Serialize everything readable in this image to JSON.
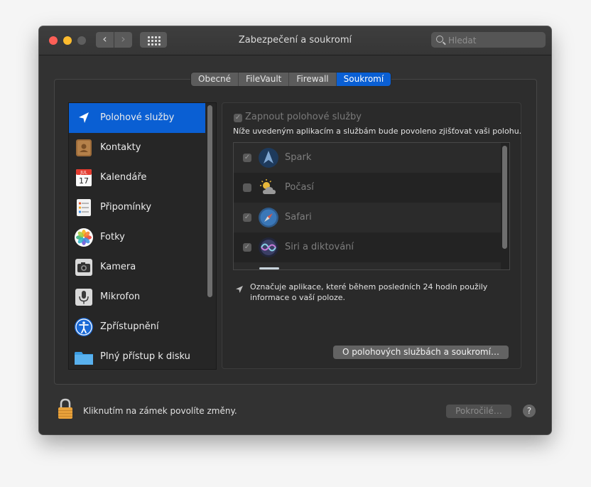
{
  "window": {
    "title": "Zabezpečení a soukromí"
  },
  "search": {
    "placeholder": "Hledat"
  },
  "tabs": [
    {
      "label": "Obecné",
      "active": false
    },
    {
      "label": "FileVault",
      "active": false
    },
    {
      "label": "Firewall",
      "active": false
    },
    {
      "label": "Soukromí",
      "active": true
    }
  ],
  "sidebar": {
    "items": [
      {
        "label": "Polohové služby",
        "icon": "location-arrow-icon",
        "selected": true
      },
      {
        "label": "Kontakty",
        "icon": "contacts-icon",
        "selected": false
      },
      {
        "label": "Kalendáře",
        "icon": "calendar-icon",
        "selected": false
      },
      {
        "label": "Připomínky",
        "icon": "reminders-icon",
        "selected": false
      },
      {
        "label": "Fotky",
        "icon": "photos-icon",
        "selected": false
      },
      {
        "label": "Kamera",
        "icon": "camera-icon",
        "selected": false
      },
      {
        "label": "Mikrofon",
        "icon": "microphone-icon",
        "selected": false
      },
      {
        "label": "Zpřístupnění",
        "icon": "accessibility-icon",
        "selected": false
      },
      {
        "label": "Plný přístup k disku",
        "icon": "folder-icon",
        "selected": false
      }
    ]
  },
  "calendar_icon": {
    "month": "JUL",
    "day": "17"
  },
  "location": {
    "enable_label": "Zapnout polohové služby",
    "enabled": true,
    "description": "Níže uvedeným aplikacím a službám bude povoleno zjišťovat vaši polohu.",
    "apps": [
      {
        "name": "Spark",
        "checked": true,
        "icon": "spark-icon"
      },
      {
        "name": "Počasí",
        "checked": false,
        "icon": "weather-icon"
      },
      {
        "name": "Safari",
        "checked": true,
        "icon": "safari-icon"
      },
      {
        "name": "Siri a diktování",
        "checked": true,
        "icon": "siri-icon"
      }
    ],
    "note": "Označuje aplikace, které během posledních 24 hodin použily informace o vaší poloze.",
    "about_button": "O polohových službách a soukromí…"
  },
  "footer": {
    "lock_text": "Kliknutím na zámek povolíte změny.",
    "advanced_button": "Pokročilé…",
    "help_label": "?"
  },
  "colors": {
    "accent": "#0a5fd3",
    "window_bg": "#323232"
  }
}
